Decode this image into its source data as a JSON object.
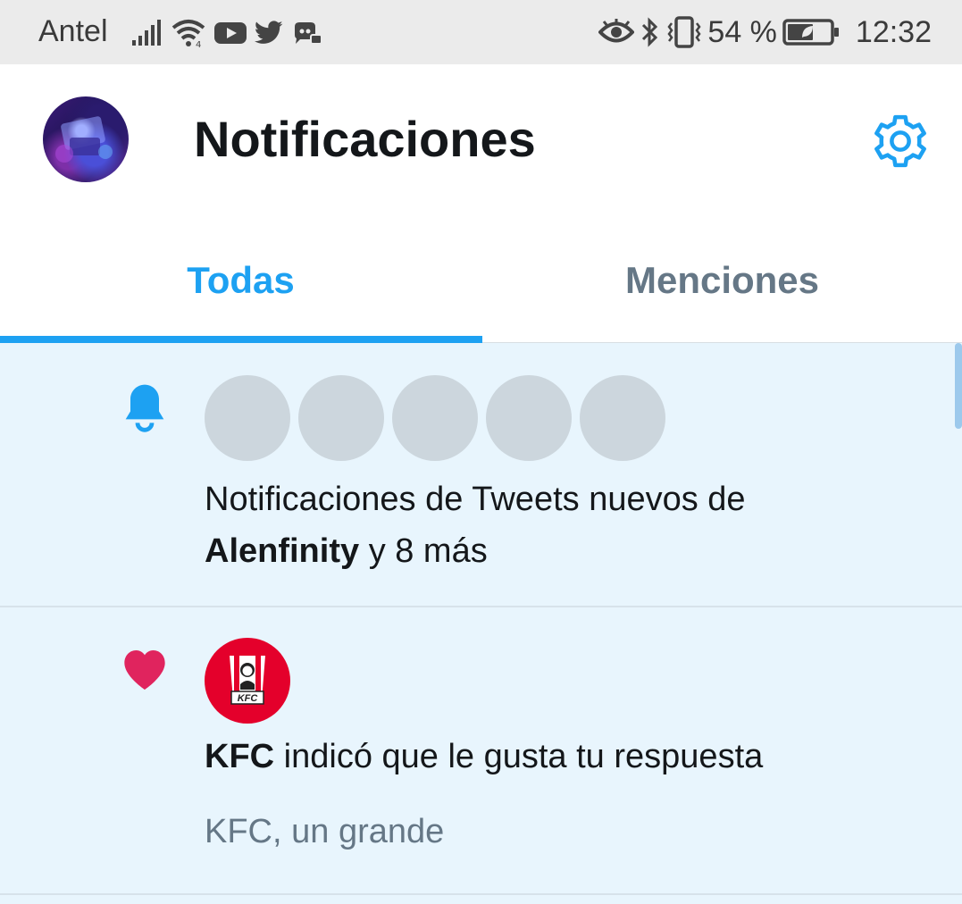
{
  "status_bar": {
    "carrier": "Antel",
    "battery_percent": "54 %",
    "time": "12:32",
    "icons_left": [
      "signal-icon",
      "wifi-icon",
      "youtube-icon",
      "twitter-icon",
      "discord-icon"
    ],
    "icons_right": [
      "eye-icon",
      "bluetooth-icon",
      "vibrate-icon",
      "battery-icon"
    ]
  },
  "header": {
    "title": "Notificaciones",
    "settings_icon": "gear-icon"
  },
  "tabs": [
    {
      "label": "Todas",
      "active": true
    },
    {
      "label": "Menciones",
      "active": false
    }
  ],
  "notifications": [
    {
      "type": "new-tweets",
      "icon": "bell-icon",
      "placeholder_avatars": 5,
      "text_prefix": "Notificaciones de Tweets nuevos de",
      "bold_name": "Alenfinity",
      "text_suffix": "y 8 más"
    },
    {
      "type": "like",
      "icon": "heart-icon",
      "avatar_label": "KFC",
      "bold_name": "KFC",
      "text": "indicó que le gusta tu respuesta",
      "subtext": "KFC, un grande"
    }
  ],
  "colors": {
    "accent": "#1da1f2",
    "like": "#e0245e",
    "list_background": "#e8f5fd",
    "placeholder": "#ccd6dd",
    "muted_text": "#657786"
  }
}
